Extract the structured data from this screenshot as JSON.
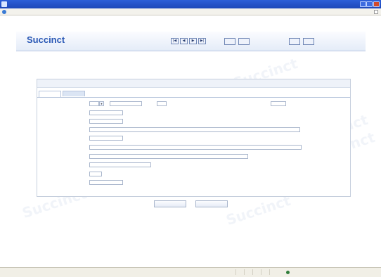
{
  "window": {
    "title": "",
    "address": ""
  },
  "app": {
    "logo": "Succinct",
    "module_title": "",
    "nav_buttons": [
      {
        "name": "first-record-button",
        "label": "|◀"
      },
      {
        "name": "prev-record-button",
        "label": "◀"
      },
      {
        "name": "next-record-button",
        "label": "▶"
      },
      {
        "name": "last-record-button",
        "label": "▶|"
      }
    ],
    "toolbar": [
      {
        "name": "toolbar-btn-1",
        "label": "",
        "enabled": true
      },
      {
        "name": "toolbar-btn-2",
        "label": "",
        "enabled": true
      },
      {
        "name": "toolbar-btn-3",
        "label": "",
        "enabled": false
      },
      {
        "name": "toolbar-btn-4",
        "label": "",
        "enabled": false
      },
      {
        "name": "toolbar-btn-5",
        "label": "",
        "enabled": false
      },
      {
        "name": "toolbar-btn-6",
        "label": "",
        "enabled": true
      },
      {
        "name": "toolbar-btn-7",
        "label": "",
        "enabled": true
      }
    ]
  },
  "panel": {
    "title_checkbox_label": "",
    "tabs": [
      "",
      ""
    ],
    "fields": [
      {
        "label": "",
        "extra_label": "",
        "right_label": ""
      },
      {
        "label": ""
      },
      {
        "label": ""
      },
      {
        "label": ""
      },
      {
        "label": ""
      },
      {
        "label": ""
      },
      {
        "label": ""
      },
      {
        "label": ""
      },
      {
        "label": ""
      },
      {
        "label": ""
      }
    ]
  },
  "actions": {
    "save": "",
    "cancel": ""
  },
  "status": {
    "left": "",
    "zone": "",
    "zoom": ""
  },
  "watermark": "Succinct"
}
